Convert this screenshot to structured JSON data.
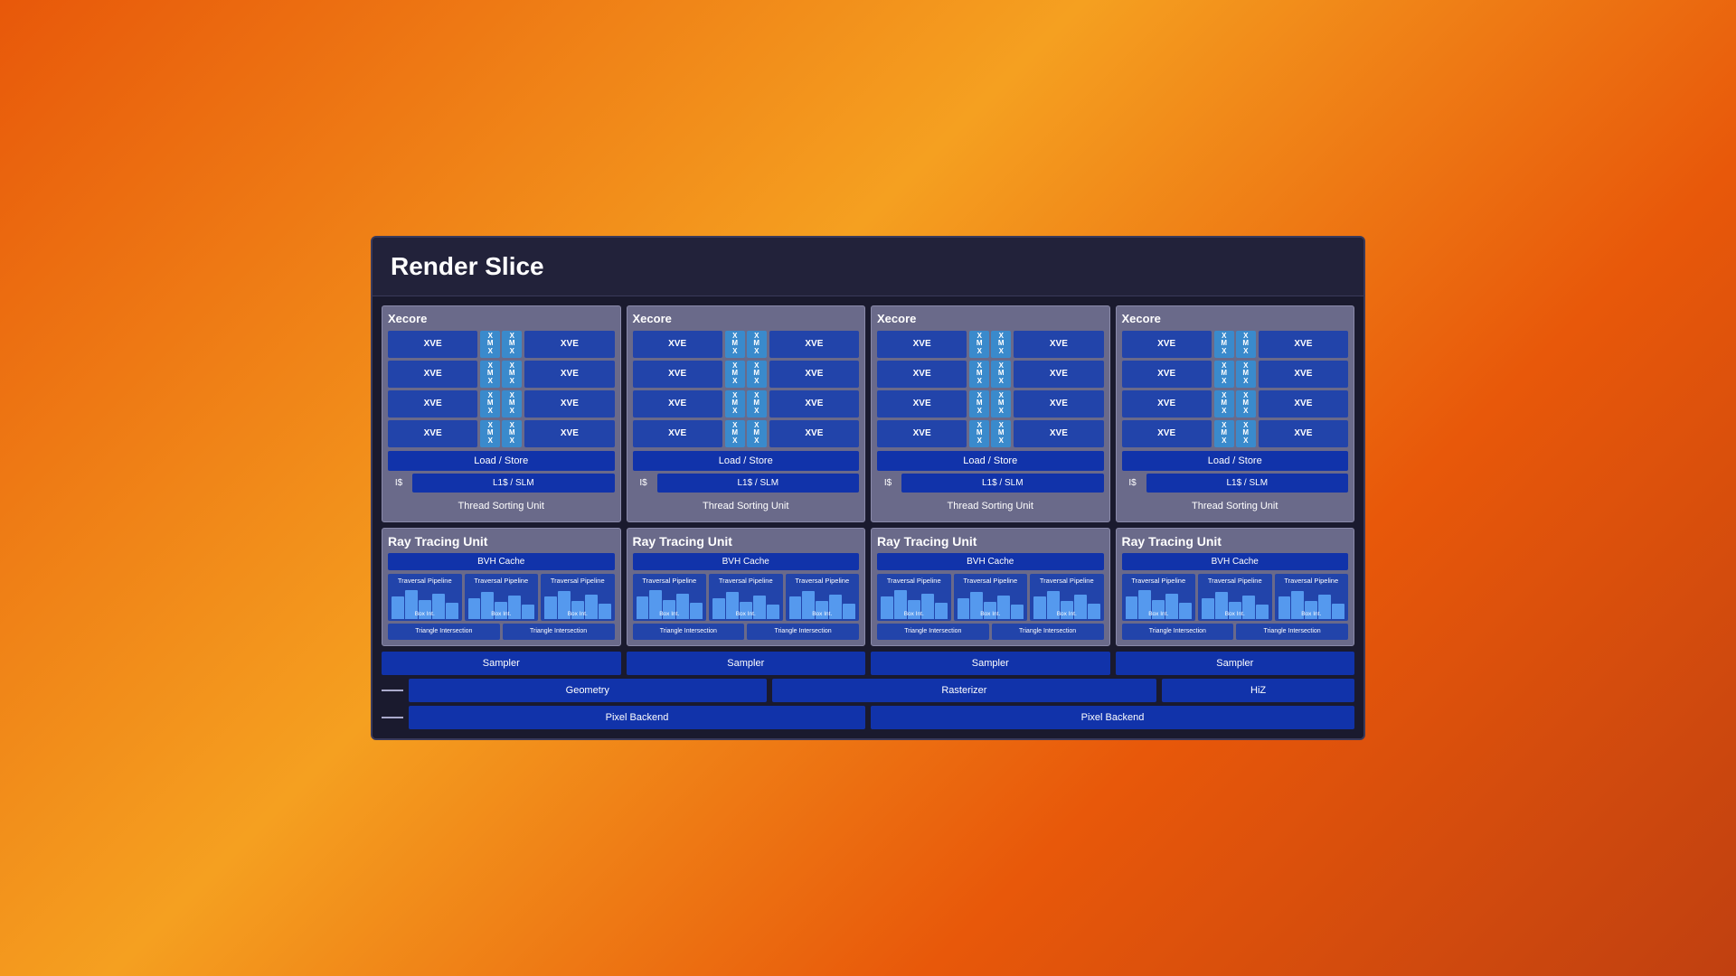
{
  "title": "Render Slice",
  "xe_core_label": "core",
  "xe_super": "e",
  "xve": "XVE",
  "xmx_labels": [
    "X\nM\nX",
    "X\nM\nX"
  ],
  "load_store": "Load / Store",
  "i_cache": "I$",
  "l1_slm": "L1$ / SLM",
  "thread_sort": "Thread Sorting Unit",
  "rt_title": "Ray Tracing Unit",
  "bvh_cache": "BVH Cache",
  "traversal_pipeline": "Traversal\nPipeline",
  "box_int": "Box Int.",
  "triangle_intersection": "Triangle\nIntersection",
  "sampler": "Sampler",
  "geometry": "Geometry",
  "rasterizer": "Rasterizer",
  "hiz": "HiZ",
  "pixel_backend": "Pixel Backend",
  "colors": {
    "bg": "#1a1a2e",
    "title_bg": "#22223a",
    "xe_core_bg": "#6a6a8a",
    "xve_bg": "#2244aa",
    "xmx_bg": "#3a8acc",
    "blue_block": "#1133aa",
    "traversal_bar": "#5599ee"
  }
}
